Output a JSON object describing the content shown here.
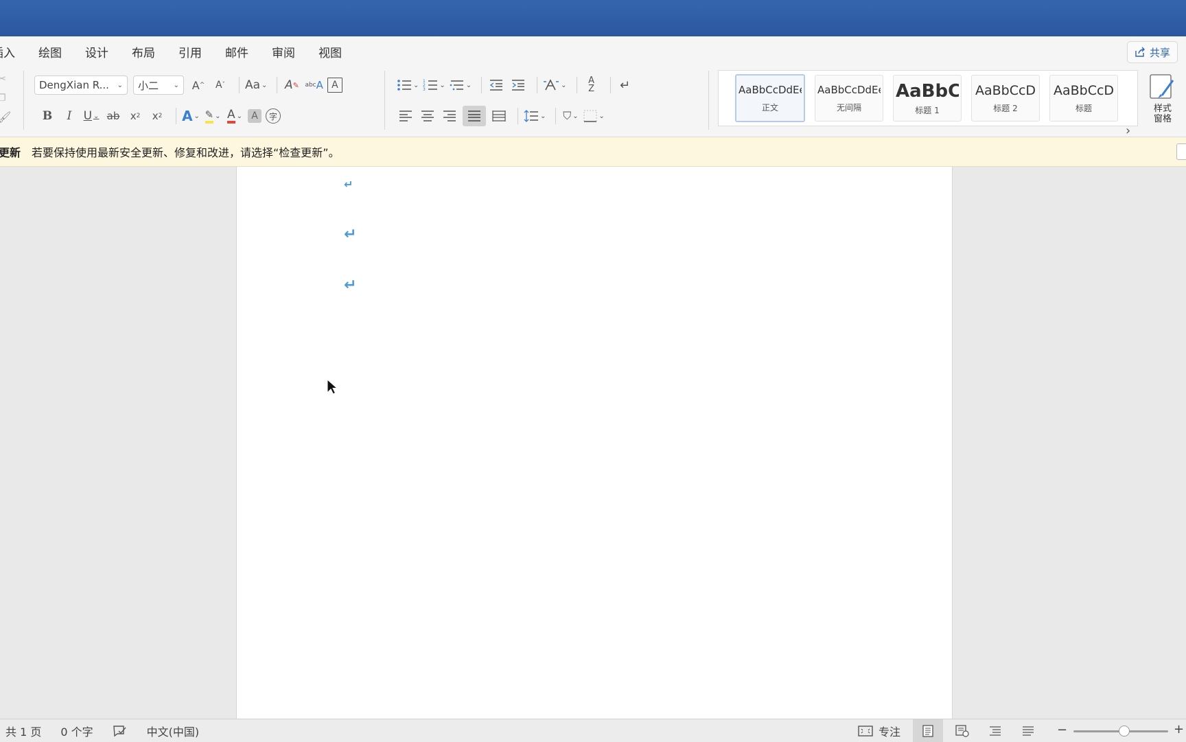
{
  "ribbon": {
    "tabs": [
      "插入",
      "绘图",
      "设计",
      "布局",
      "引用",
      "邮件",
      "审阅",
      "视图"
    ],
    "share_label": "共享",
    "font_name": "DengXian R...",
    "font_size": "小二",
    "change_case_label": "Aa",
    "styles": [
      {
        "preview": "AaBbCcDdEe",
        "name": "正文"
      },
      {
        "preview": "AaBbCcDdEe",
        "name": "无间隔"
      },
      {
        "preview": "AaBbC",
        "name": "标题 1"
      },
      {
        "preview": "AaBbCcD",
        "name": "标题 2"
      },
      {
        "preview": "AaBbCcD",
        "name": "标题"
      }
    ],
    "styles_pane_label": "样式\n窗格"
  },
  "infobar": {
    "title": "更新",
    "message": "若要保持使用最新安全更新、修复和改进，请选择“检查更新”。"
  },
  "document": {
    "paragraph_marks": [
      "↵",
      "↵",
      "↵"
    ]
  },
  "status": {
    "pages": "共 1 页",
    "words": "0 个字",
    "language": "中文(中国)",
    "focus": "专注"
  },
  "colors": {
    "titlebar": "#2f5ea7",
    "accent": "#2f63b3",
    "infobar_bg": "#fdf7df",
    "paragraph_mark": "#4e9ad6",
    "font_color_bar": "#e0473d",
    "highlight_bar": "#f2e54d"
  }
}
